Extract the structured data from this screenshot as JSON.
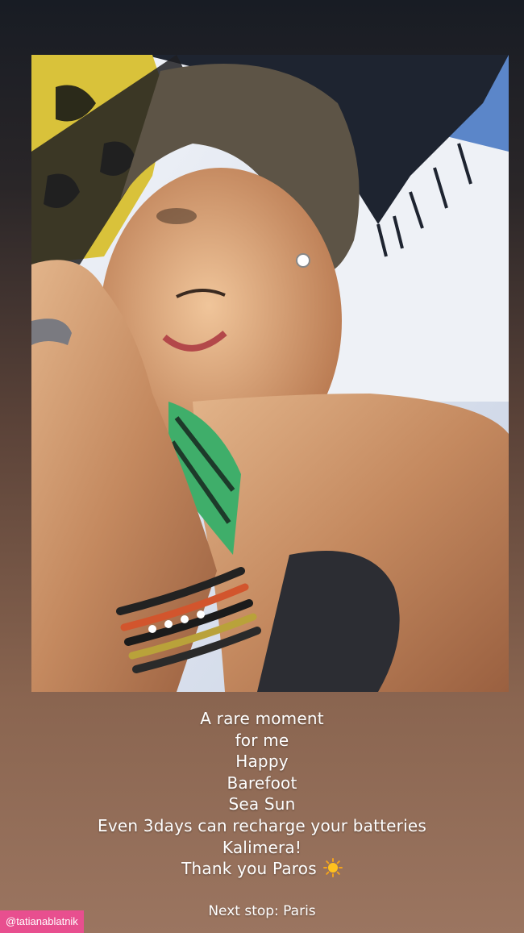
{
  "story": {
    "caption_lines": [
      "A rare moment",
      "for me",
      "Happy",
      "Barefoot",
      "Sea Sun",
      "Even 3days can recharge your batteries",
      "Kalimera!",
      "Thank you Paros"
    ],
    "next_stop": "Next stop: Paris",
    "mention": "@tatianablatnik",
    "emoji": "sun-emoji"
  },
  "colors": {
    "mention_bg": "#e84f8f",
    "text": "#ffffff",
    "background_top": "#181c24",
    "background_bottom": "#9b7560"
  }
}
